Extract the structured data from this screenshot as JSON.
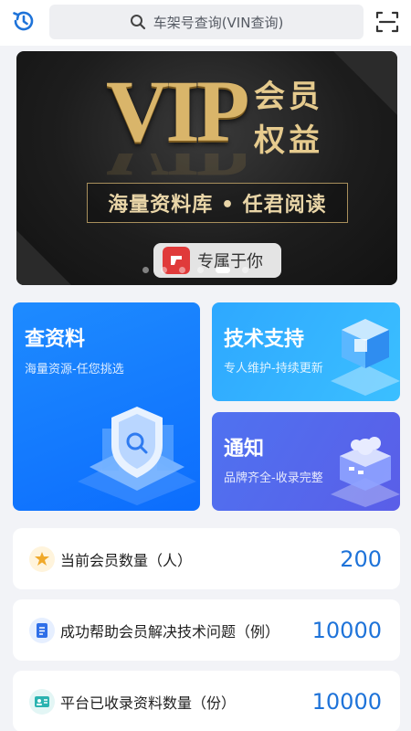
{
  "search": {
    "placeholder": "车架号查询(VIN查询)"
  },
  "icons": {
    "history": "history-icon",
    "search": "search-icon",
    "scan": "scan-icon"
  },
  "banner": {
    "logo_text": "VIP",
    "member_line1": "会员",
    "member_line2": "权益",
    "slogan": "海量资料库 • 任君阅读",
    "badge_text": "专属于你",
    "dots": 6,
    "active_dot": 4
  },
  "cards": {
    "search": {
      "title": "查资料",
      "subtitle": "海量资源-任您挑选"
    },
    "tech": {
      "title": "技术支持",
      "subtitle": "专人维护-持续更新"
    },
    "notice": {
      "title": "通知",
      "subtitle": "品牌齐全-收录完整"
    }
  },
  "stats": [
    {
      "label": "当前会员数量（人）",
      "value": "200",
      "icon": "medal-icon",
      "icon_bg": "#fff4dc"
    },
    {
      "label": "成功帮助会员解决技术问题（例）",
      "value": "10000",
      "icon": "document-icon",
      "icon_bg": "#e6efff"
    },
    {
      "label": "平台已收录资料数量（份）",
      "value": "10000",
      "icon": "id-card-icon",
      "icon_bg": "#e3f6f5"
    }
  ],
  "colors": {
    "accent": "#1e73d9",
    "primary_blue": "#0c6dfd",
    "sky_blue": "#3bbfff",
    "indigo": "#5a5ee8",
    "gold": "#d9b56a"
  }
}
